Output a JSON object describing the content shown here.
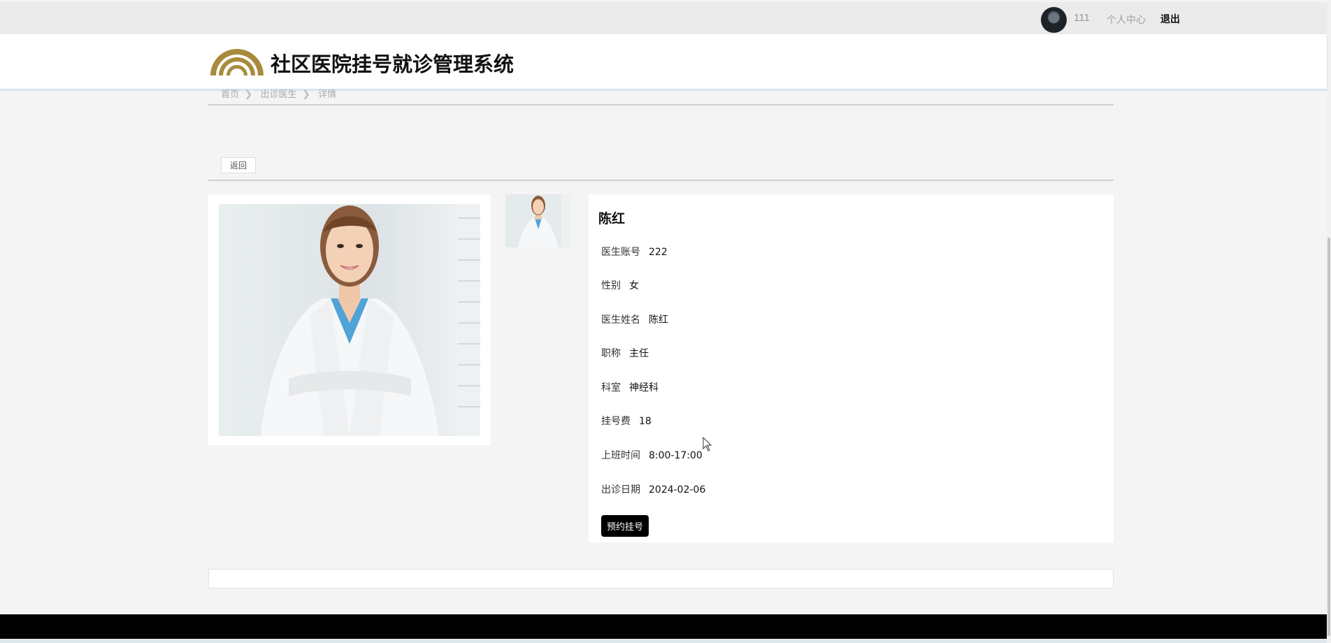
{
  "topbar": {
    "username": "111",
    "center_link": "个人中心",
    "logout_link": "退出"
  },
  "header": {
    "site_title": "社区医院挂号就诊管理系统"
  },
  "breadcrumb": {
    "items": [
      "首页",
      "出诊医生",
      "详情"
    ]
  },
  "actions": {
    "back_label": "返回",
    "book_label": "预约挂号"
  },
  "doctor": {
    "name": "陈红",
    "fields": [
      {
        "label": "医生账号",
        "value": "222"
      },
      {
        "label": "性别",
        "value": "女"
      },
      {
        "label": "医生姓名",
        "value": "陈红"
      },
      {
        "label": "职称",
        "value": "主任"
      },
      {
        "label": "科室",
        "value": "神经科"
      },
      {
        "label": "挂号费",
        "value": "18"
      },
      {
        "label": "上班时间",
        "value": "8:00-17:00"
      },
      {
        "label": "出诊日期",
        "value": "2024-02-06"
      }
    ]
  },
  "colors": {
    "logo_gold": "#a88b3b",
    "footer": "#000000",
    "page_bg": "#f4f4f4"
  }
}
